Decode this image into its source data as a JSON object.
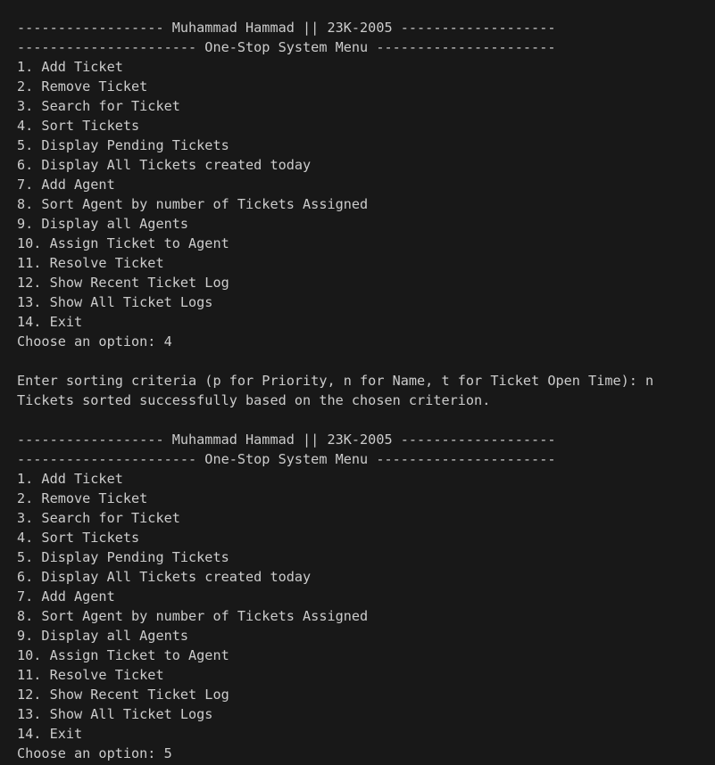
{
  "terminal": {
    "blocks": [
      {
        "header": "------------------ Muhammad Hammad || 23K-2005 -------------------",
        "title_bar": "---------------------- One-Stop System Menu ----------------------",
        "menu": [
          "1. Add Ticket",
          "2. Remove Ticket",
          "3. Search for Ticket",
          "4. Sort Tickets",
          "5. Display Pending Tickets",
          "6. Display All Tickets created today",
          "7. Add Agent",
          "8. Sort Agent by number of Tickets Assigned",
          "9. Display all Agents",
          "10. Assign Ticket to Agent",
          "11. Resolve Ticket",
          "12. Show Recent Ticket Log",
          "13. Show All Ticket Logs",
          "14. Exit"
        ],
        "prompt": "Choose an option: 4"
      },
      {
        "header": "------------------ Muhammad Hammad || 23K-2005 -------------------",
        "title_bar": "---------------------- One-Stop System Menu ----------------------",
        "menu": [
          "1. Add Ticket",
          "2. Remove Ticket",
          "3. Search for Ticket",
          "4. Sort Tickets",
          "5. Display Pending Tickets",
          "6. Display All Tickets created today",
          "7. Add Agent",
          "8. Sort Agent by number of Tickets Assigned",
          "9. Display all Agents",
          "10. Assign Ticket to Agent",
          "11. Resolve Ticket",
          "12. Show Recent Ticket Log",
          "13. Show All Ticket Logs",
          "14. Exit"
        ],
        "prompt": "Choose an option: 5"
      }
    ],
    "sort_prompt": "Enter sorting criteria (p for Priority, n for Name, t for Ticket Open Time): n",
    "sort_result": "Tickets sorted successfully based on the chosen criterion."
  },
  "colors": {
    "background": "#181818",
    "text": "#cccccc"
  }
}
